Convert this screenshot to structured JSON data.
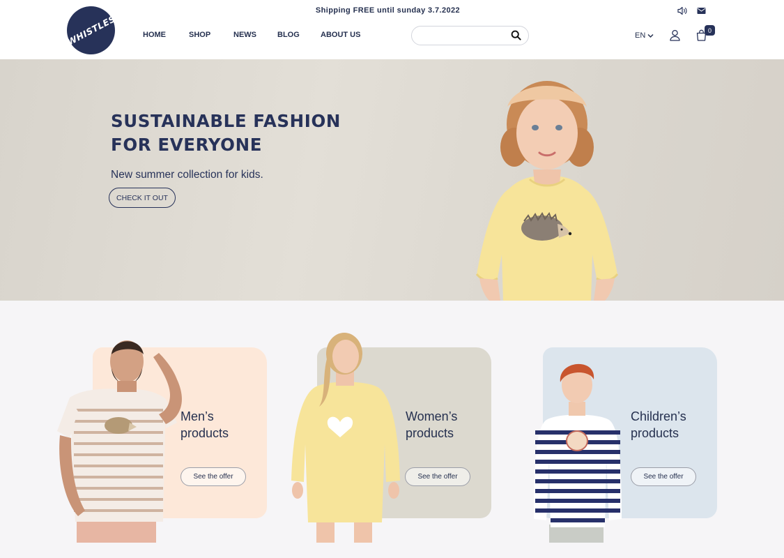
{
  "header": {
    "logo_text": "WHISTLES",
    "promo": "Shipping FREE until sunday 3.7.2022",
    "nav": [
      {
        "label": "HOME"
      },
      {
        "label": "SHOP"
      },
      {
        "label": "NEWS"
      },
      {
        "label": "BLOG"
      },
      {
        "label": "ABOUT US"
      }
    ],
    "search": {
      "value": "",
      "placeholder": ""
    },
    "language": "EN",
    "cart_count": "0",
    "icons": [
      "sound-icon",
      "mail-icon",
      "search-icon",
      "chevron-down-icon",
      "user-icon",
      "cart-icon"
    ]
  },
  "hero": {
    "title_line1": "SUSTAINABLE FASHION",
    "title_line2": "FOR EVERYONE",
    "subtitle": "New summer collection for kids.",
    "cta": "CHECK IT OUT"
  },
  "categories": [
    {
      "title_line1": "Men’s",
      "title_line2": "products",
      "button": "See the offer",
      "color": "#fde8d9"
    },
    {
      "title_line1": "Women’s",
      "title_line2": "products",
      "button": "See the offer",
      "color": "#dcd9cf"
    },
    {
      "title_line1": "Children’s",
      "title_line2": "products",
      "button": "See the offer",
      "color": "#dce5ed"
    }
  ],
  "colors": {
    "brand_navy": "#273259",
    "page_bg": "#f6f5f7",
    "hero_bg": "#e1ddd5"
  }
}
